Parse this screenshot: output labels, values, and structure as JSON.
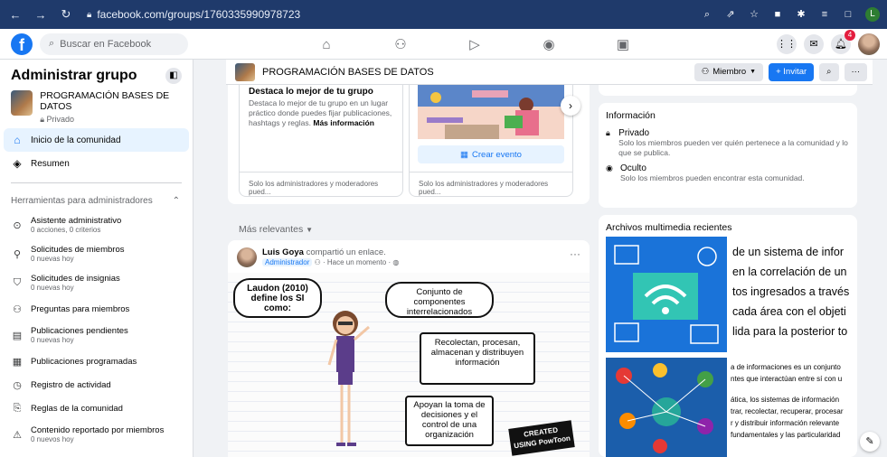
{
  "browser": {
    "url": "facebook.com/groups/1760335990978723",
    "profile_initial": "L"
  },
  "fb": {
    "search_placeholder": "Buscar en Facebook",
    "notification_count": "4"
  },
  "sidebar": {
    "title": "Administrar grupo",
    "group_name": "PROGRAMACIÓN BASES DE DATOS",
    "group_privacy": "Privado",
    "nav": [
      {
        "label": "Inicio de la comunidad",
        "icon": "home-icon"
      },
      {
        "label": "Resumen",
        "icon": "overview-icon"
      }
    ],
    "tools_header": "Herramientas para administradores",
    "tools": [
      {
        "label": "Asistente administrativo",
        "sub": "0 acciones, 0 criterios"
      },
      {
        "label": "Solicitudes de miembros",
        "sub": "0 nuevas hoy"
      },
      {
        "label": "Solicitudes de insignias",
        "sub": "0 nuevas hoy"
      },
      {
        "label": "Preguntas para miembros",
        "sub": ""
      },
      {
        "label": "Publicaciones pendientes",
        "sub": "0 nuevas hoy"
      },
      {
        "label": "Publicaciones programadas",
        "sub": ""
      },
      {
        "label": "Registro de actividad",
        "sub": ""
      },
      {
        "label": "Reglas de la comunidad",
        "sub": ""
      },
      {
        "label": "Contenido reportado por miembros",
        "sub": "0 nuevos hoy"
      }
    ]
  },
  "groupbar": {
    "title": "PROGRAMACIÓN BASES DE DATOS",
    "member_label": "Miembro",
    "invite_label": "+ Invitar",
    "more_label": "···"
  },
  "prompts": {
    "card1_title": "Destaca lo mejor de tu grupo",
    "card1_text": "Destaca lo mejor de tu grupo en un lugar práctico donde puedes fijar publicaciones, hashtags y reglas.",
    "card1_link": "Más información",
    "card1_footer": "Solo los administradores y moderadores pued...",
    "card2_button": "Crear evento",
    "card2_footer": "Solo los administradores y moderadores pued..."
  },
  "info": {
    "title": "Información",
    "items": [
      {
        "title": "Privado",
        "desc": "Solo los miembros pueden ver quién pertenece a la comunidad y lo que se publica."
      },
      {
        "title": "Oculto",
        "desc": "Solo los miembros pueden encontrar esta comunidad."
      }
    ]
  },
  "feed": {
    "sort_label": "Más relevantes",
    "post_author": "Luis Goya",
    "post_action": "compartió un enlace.",
    "post_role": "Administrador",
    "post_time": "· Hace un momento ·",
    "bubble1": "Laudon (2010) define los SI como:",
    "bubble2": "Conjunto de componentes interrelacionados",
    "bubble3": "Recolectan, procesan, almacenan y distribuyen información",
    "bubble4": "Apoyan la toma de decisiones y el control de una organización",
    "watermark": "CREATED USING PowToon"
  },
  "media": {
    "title": "Archivos multimedia recientes",
    "lines_top": [
      "de un sistema de infor",
      "en la correlación de un",
      "tos ingresados a través",
      "cada área con el objeti",
      "lida para la posterior to"
    ],
    "lines_bottom": [
      "a de informaciones es un conjunto",
      "ntes que interactúan entre sí con u",
      "ática, los sistemas de información",
      "trar, recolectar, recuperar, procesar",
      "r y distribuir información relevante",
      "fundamentales y las particularidad"
    ]
  }
}
